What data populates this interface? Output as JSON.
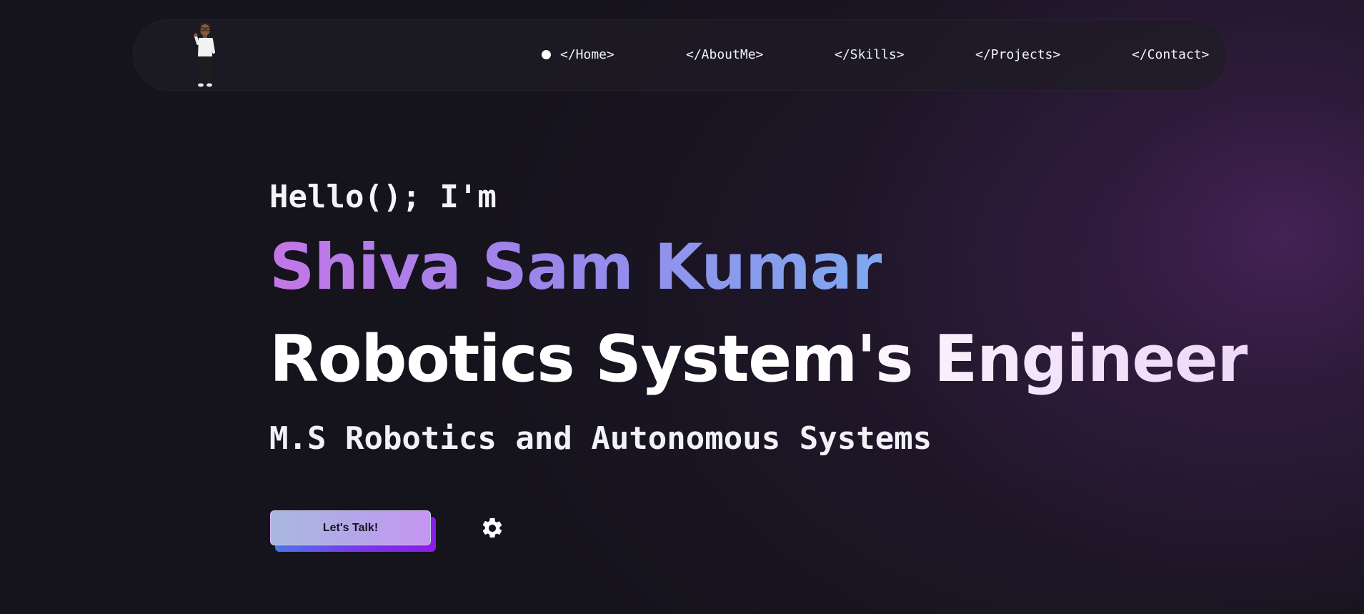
{
  "nav": {
    "links": [
      {
        "label": "</Home>",
        "active": true
      },
      {
        "label": "</AboutMe>",
        "active": false
      },
      {
        "label": "</Skills>",
        "active": false
      },
      {
        "label": "</Projects>",
        "active": false
      },
      {
        "label": "</Contact>",
        "active": false
      }
    ],
    "avatar_icon": "memoji-avatar-icon"
  },
  "hero": {
    "greeting": "Hello(); I'm",
    "name": "Shiva Sam Kumar",
    "role": "Robotics System's Engineer",
    "degree": "M.S Robotics and Autonomous Systems",
    "cta_label": "Let's Talk!",
    "settings_icon": "gear-icon"
  },
  "colors": {
    "background": "#15131c",
    "name_gradient_start": "#c476e6",
    "name_gradient_end": "#7ea9ef",
    "cta_gradient_start": "#a9b8df",
    "cta_gradient_end": "#c595f1",
    "cta_shadow_end": "#8b1be8"
  }
}
